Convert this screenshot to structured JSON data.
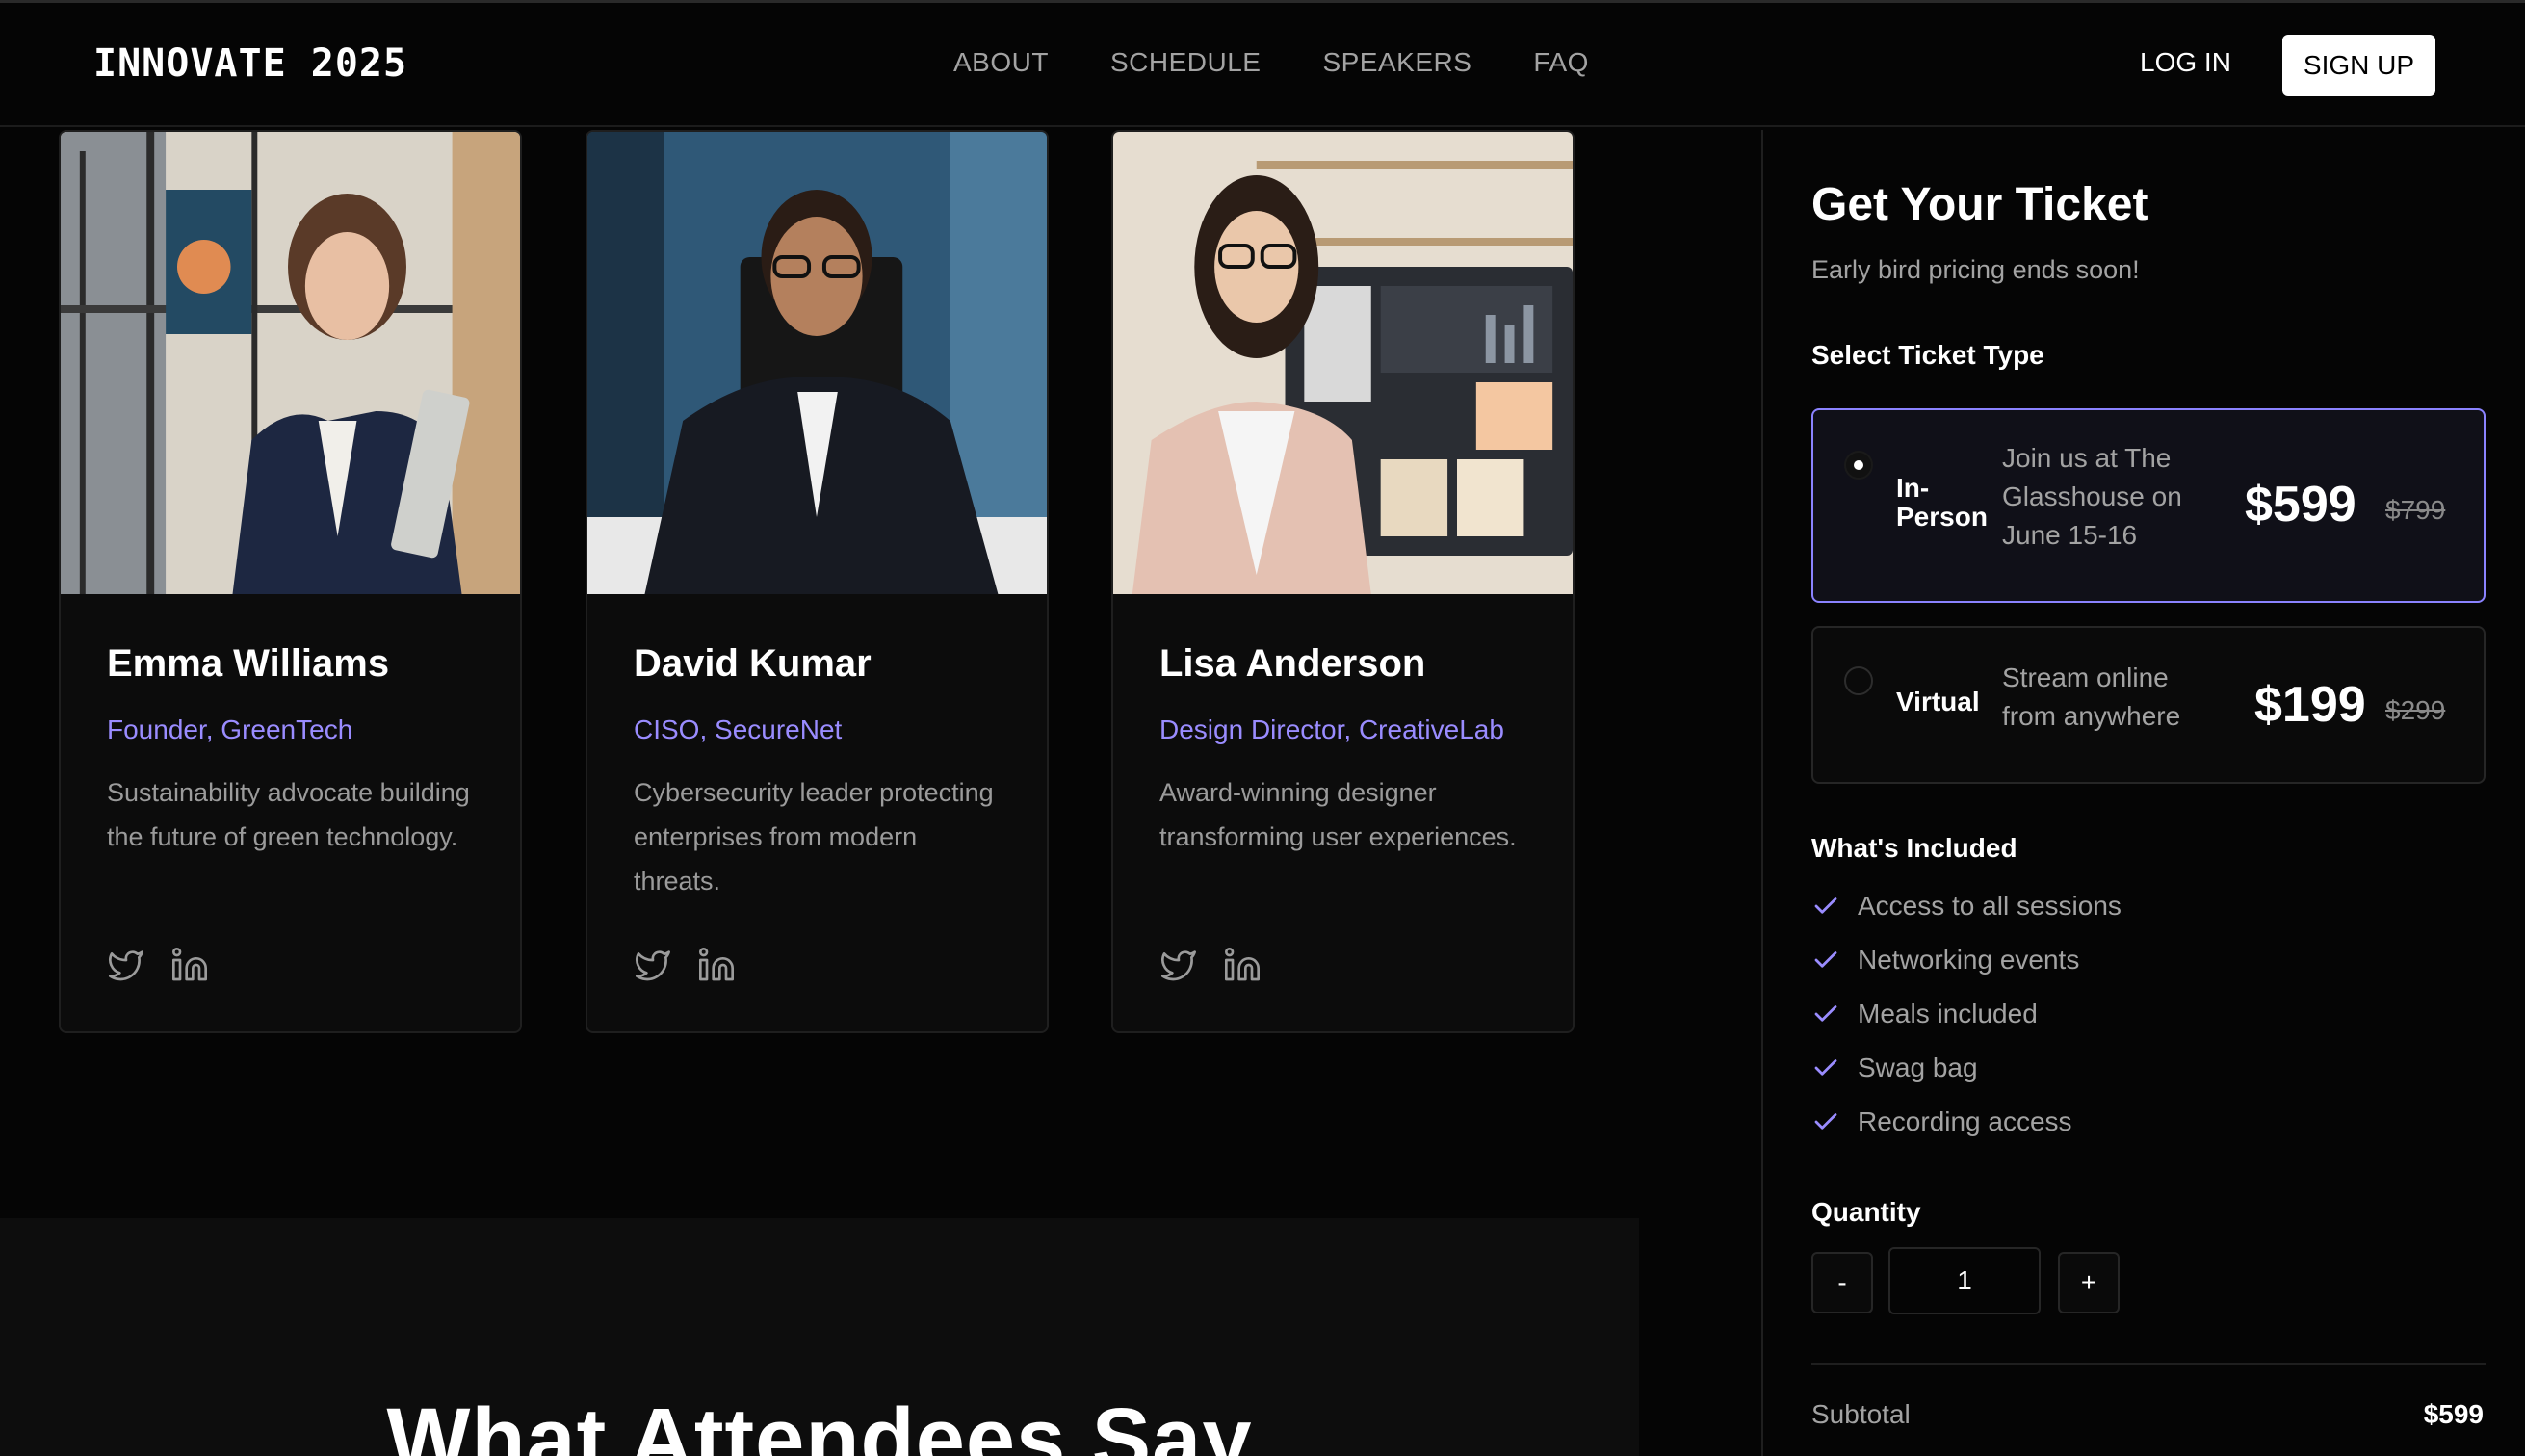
{
  "header": {
    "brand": "INNOVATE 2025",
    "nav": [
      "ABOUT",
      "SCHEDULE",
      "SPEAKERS",
      "FAQ"
    ],
    "login": "LOG IN",
    "signup": "SIGN UP"
  },
  "speakers": [
    {
      "name": "Emma Williams",
      "role": "Founder, GreenTech",
      "bio": "Sustainability advocate building the future of green technology.",
      "icons": [
        "twitter-icon",
        "linkedin-icon"
      ]
    },
    {
      "name": "David Kumar",
      "role": "CISO, SecureNet",
      "bio": "Cybersecurity leader protecting enterprises from modern threats.",
      "icons": [
        "twitter-icon",
        "linkedin-icon"
      ]
    },
    {
      "name": "Lisa Anderson",
      "role": "Design Director, CreativeLab",
      "bio": "Award-winning designer transforming user experiences.",
      "icons": [
        "twitter-icon",
        "linkedin-icon"
      ]
    }
  ],
  "testimonials": {
    "title": "What Attendees Say"
  },
  "ticket": {
    "title": "Get Your Ticket",
    "subtitle": "Early bird pricing ends soon!",
    "select_label": "Select Ticket Type",
    "options": [
      {
        "name": "In-Person",
        "desc": "Join us at The Glasshouse on June 15-16",
        "price": "$599",
        "old_price": "$799",
        "selected": true
      },
      {
        "name": "Virtual",
        "desc": "Stream online from anywhere",
        "price": "$199",
        "old_price": "$299",
        "selected": false
      }
    ],
    "included_label": "What's Included",
    "included": [
      "Access to all sessions",
      "Networking events",
      "Meals included",
      "Swag bag",
      "Recording access"
    ],
    "quantity_label": "Quantity",
    "quantity": "1",
    "minus": "-",
    "plus": "+",
    "subtotal_label": "Subtotal",
    "subtotal": "$599"
  },
  "colors": {
    "accent": "#9a8cff",
    "background": "#050505",
    "card": "#0c0c0c"
  }
}
